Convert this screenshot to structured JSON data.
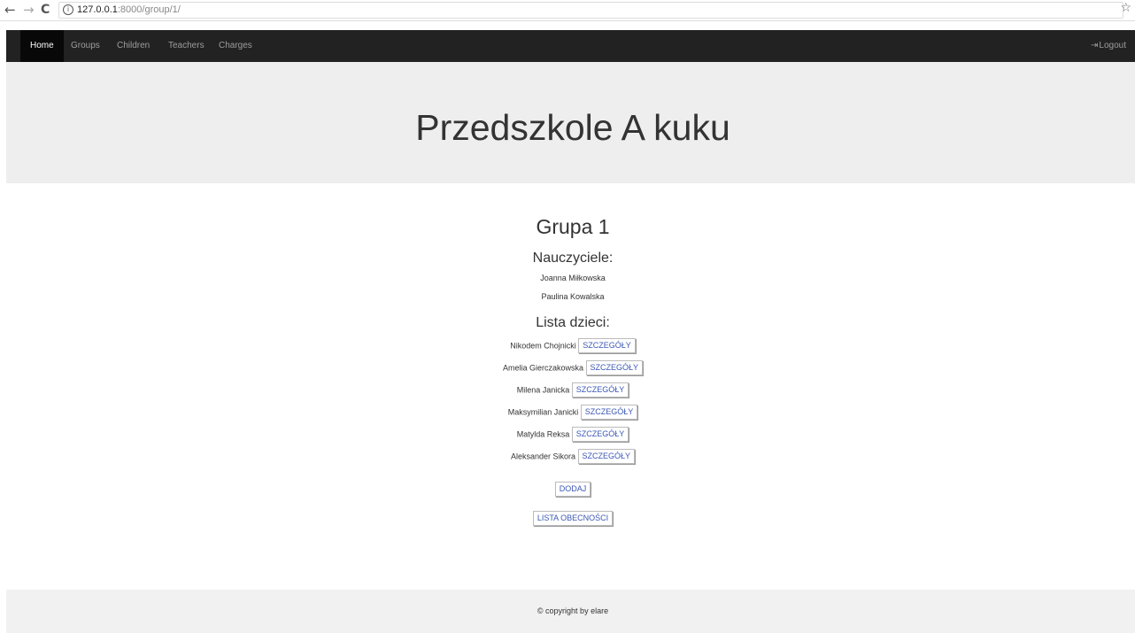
{
  "browser": {
    "url_host": "127.0.0.1",
    "url_path": ":8000/group/1/"
  },
  "navbar": {
    "items": [
      {
        "label": "Home"
      },
      {
        "label": "Groups"
      },
      {
        "label": "Children"
      },
      {
        "label": "Teachers"
      },
      {
        "label": "Charges"
      }
    ],
    "logout_label": "Logout"
  },
  "jumbotron": {
    "title": "Przedszkole A kuku"
  },
  "group": {
    "title": "Grupa 1",
    "teachers_heading": "Nauczyciele:",
    "teachers": [
      "Joanna Miłkowska",
      "Paulina Kowalska"
    ],
    "children_heading": "Lista dzieci:",
    "children": [
      {
        "name": "Nikodem Chojnicki",
        "button": "SZCZEGÓŁY"
      },
      {
        "name": "Amelia Gierczakowska",
        "button": "SZCZEGÓŁY"
      },
      {
        "name": "Milena Janicka",
        "button": "SZCZEGÓŁY"
      },
      {
        "name": "Maksymilian Janicki",
        "button": "SZCZEGÓŁY"
      },
      {
        "name": "Matylda Reksa",
        "button": "SZCZEGÓŁY"
      },
      {
        "name": "Aleksander Sikora",
        "button": "SZCZEGÓŁY"
      }
    ],
    "add_button": "DODAJ",
    "attendance_button": "LISTA OBECNOŚCI"
  },
  "footer": {
    "text": "© copyright by elare"
  },
  "icons": {
    "back": "arrow-left-icon",
    "forward": "arrow-right-icon",
    "reload": "reload-icon",
    "info": "info-icon",
    "bookmark": "star-icon",
    "logout": "login-icon"
  },
  "colors": {
    "navbar_bg": "#222222",
    "jumbotron_bg": "#eeeeee",
    "footer_bg": "#f1f1f1",
    "button_text": "#3a57b5"
  }
}
